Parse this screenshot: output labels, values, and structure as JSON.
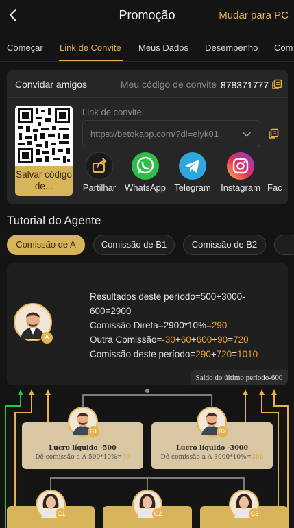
{
  "header": {
    "title": "Promoção",
    "switch_label": "Mudar para PC"
  },
  "tabs": [
    "Começar",
    "Link de Convite",
    "Meus Dados",
    "Desempenho",
    "Com"
  ],
  "invite": {
    "title": "Convidar amigos",
    "code_label": "Meu código de convite",
    "code_value": "878371777",
    "save_label": "Salvar código de...",
    "link_label": "Link de convite",
    "link_value": "https://betokapp.com/?dl=eiyk01",
    "share": [
      {
        "label": "Partilhar",
        "icon": "share-icon"
      },
      {
        "label": "WhatsApp",
        "icon": "whatsapp-icon"
      },
      {
        "label": "Telegram",
        "icon": "telegram-icon"
      },
      {
        "label": "Instagram",
        "icon": "instagram-icon"
      },
      {
        "label": "Fac",
        "icon": "facebook-icon"
      }
    ]
  },
  "tutorial": {
    "title": "Tutorial do Agente",
    "pills": [
      "Comissão de A",
      "Comissão de B1",
      "Comissão de B2",
      ""
    ],
    "agent_badge": "A",
    "results": {
      "line1": "Resultados deste período=500+3000-600=2900",
      "comissao_direta_prefix": "Comissão Direta=2900*10%=",
      "comissao_direta_value": "290",
      "outra_prefix": "Outra Comissão=",
      "outra_n1": "-30",
      "outra_n2": "60",
      "outra_n3": "600",
      "outra_n4": "90",
      "outra_total": "720",
      "periodo_prefix": "Comissão deste período=",
      "periodo_n1": "290",
      "periodo_n2": "720",
      "periodo_total": "1010"
    },
    "balance": "Saldo do último período-600",
    "b1": {
      "badge": "B1",
      "title": "Lucro líquido -500",
      "sub_prefix": "Dê comissão a A 500*10%=",
      "sub_value": "50"
    },
    "b2": {
      "badge": "B2",
      "title": "Lucro líquido -3000",
      "sub_prefix": "Dê comissão a A 3000*10%=",
      "sub_value": "300"
    },
    "c_badges": [
      "C1",
      "C2",
      "C3"
    ]
  },
  "colors": {
    "accent": "#e4b34c",
    "orange": "#f0a030",
    "green": "#26c24a",
    "card": "#262626",
    "b_card": "#d8c7a2"
  }
}
